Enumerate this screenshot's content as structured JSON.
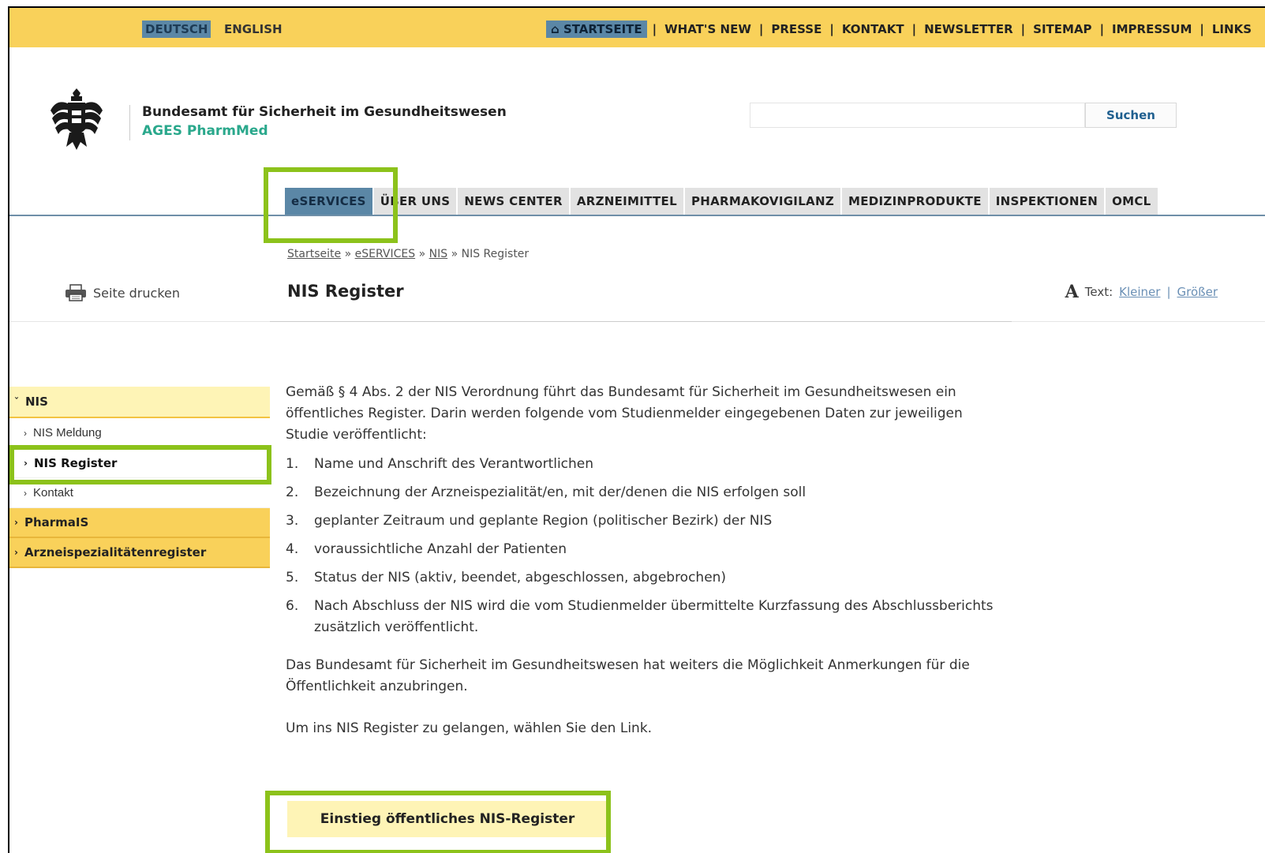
{
  "lang": {
    "de": "DEUTSCH",
    "en": "ENGLISH"
  },
  "topnav": [
    "STARTSEITE",
    "WHAT'S NEW",
    "PRESSE",
    "KONTAKT",
    "NEWSLETTER",
    "SITEMAP",
    "IMPRESSUM",
    "LINKS"
  ],
  "header": {
    "org_line1": "Bundesamt für Sicherheit im Gesundheitswesen",
    "org_line2": "AGES PharmMed",
    "search_button": "Suchen",
    "search_placeholder": ""
  },
  "mainnav": [
    "eSERVICES",
    "ÜBER UNS",
    "NEWS CENTER",
    "ARZNEIMITTEL",
    "PHARMAKOVIGILANZ",
    "MEDIZINPRODUKTE",
    "INSPEKTIONEN",
    "OMCL"
  ],
  "breadcrumb": {
    "home": "Startseite",
    "eservices": "eSERVICES",
    "nis": "NIS",
    "current": "NIS Register",
    "sep": "»"
  },
  "print_label": "Seite drucken",
  "page_title": "NIS Register",
  "textsize": {
    "label": "Text:",
    "smaller": "Kleiner",
    "bigger": "Größer",
    "icon_letter": "A"
  },
  "sidebar": {
    "nis": "NIS",
    "items": [
      "NIS Meldung",
      "NIS Register",
      "Kontakt"
    ],
    "pharmais": "PharmaIS",
    "register": "Arzneispezialitätenregister"
  },
  "content": {
    "intro": "Gemäß § 4 Abs. 2 der NIS Verordnung führt das Bundesamt für Sicherheit im Gesundheitswesen ein öffentliches Register. Darin werden folgende vom Studienmelder eingegebenen Daten zur jeweiligen Studie veröffentlicht:",
    "list": [
      {
        "n": "1.",
        "t": "Name und Anschrift des Verantwortlichen"
      },
      {
        "n": "2.",
        "t": "Bezeichnung der Arzneispezialität/en, mit der/denen die NIS  erfolgen soll"
      },
      {
        "n": "3.",
        "t": "geplanter Zeitraum und geplante Region (politischer Bezirk) der NIS"
      },
      {
        "n": "4.",
        "t": "voraussichtliche Anzahl der Patienten"
      },
      {
        "n": "5.",
        "t": "Status der NIS (aktiv, beendet, abgeschlossen, abgebrochen)"
      },
      {
        "n": "6.",
        "t": "Nach Abschluss der NIS wird die vom Studienmelder übermittelte Kurzfassung des Abschlussberichts zusätzlich veröffentlicht."
      }
    ],
    "p2": "Das Bundesamt für Sicherheit im Gesundheitswesen hat weiters die Möglichkeit Anmerkungen für die Öffentlichkeit anzubringen.",
    "p3": "Um ins NIS Register zu gelangen, wählen Sie den Link.",
    "entry_button": "Einstieg öffentliches NIS-Register"
  },
  "colors": {
    "yellow": "#f9d15a",
    "steel_blue": "#5b87a6",
    "green_highlight": "#8cc21b",
    "teal": "#2aa88c"
  }
}
